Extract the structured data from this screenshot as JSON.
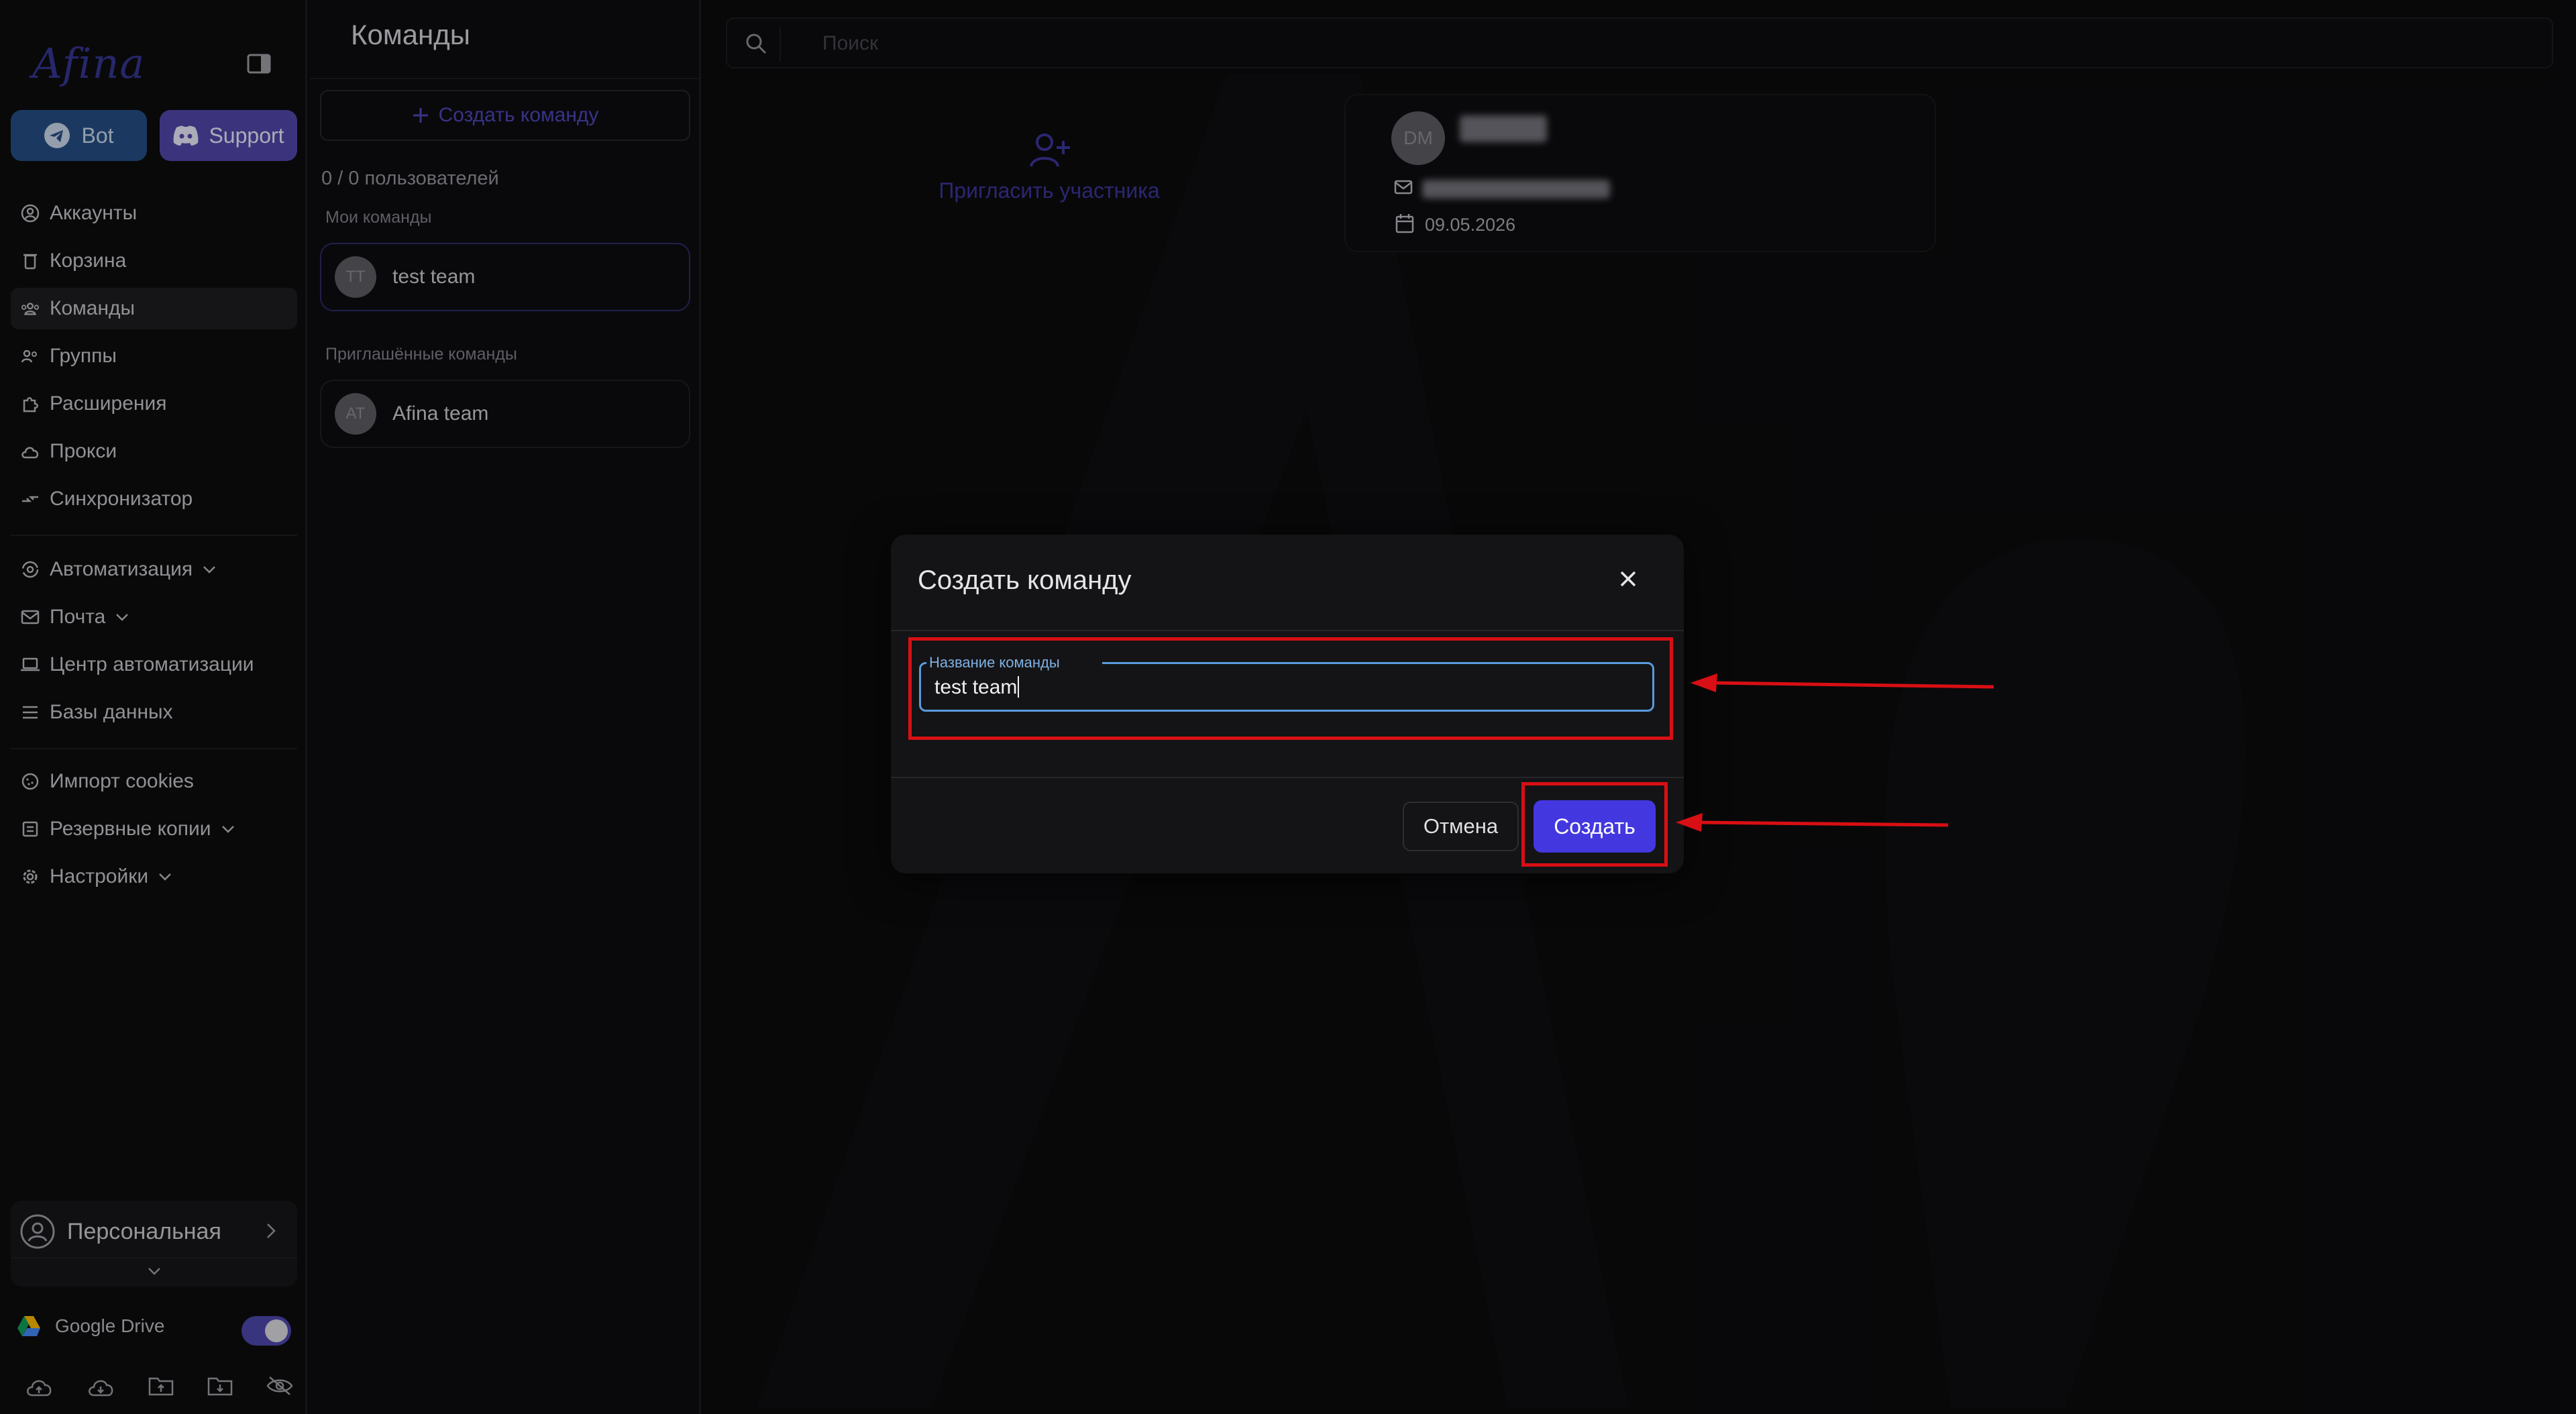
{
  "sidebar": {
    "logo": "Afina",
    "bot_label": "Bot",
    "support_label": "Support",
    "items": [
      {
        "label": "Аккаунты",
        "icon": "user-circle-icon"
      },
      {
        "label": "Корзина",
        "icon": "trash-icon"
      },
      {
        "label": "Команды",
        "icon": "team-icon",
        "active": true
      },
      {
        "label": "Группы",
        "icon": "users-group-icon"
      },
      {
        "label": "Расширения",
        "icon": "puzzle-icon"
      },
      {
        "label": "Прокси",
        "icon": "cloud-icon"
      },
      {
        "label": "Синхронизатор",
        "icon": "sync-icon"
      },
      {
        "label": "Автоматизация",
        "icon": "automation-icon",
        "expandable": true
      },
      {
        "label": "Почта",
        "icon": "mail-icon",
        "expandable": true
      },
      {
        "label": "Центр автоматизации",
        "icon": "laptop-icon"
      },
      {
        "label": "Базы данных",
        "icon": "list-icon"
      },
      {
        "label": "Импорт cookies",
        "icon": "cookie-icon"
      },
      {
        "label": "Резервные копии",
        "icon": "backup-icon",
        "expandable": true
      },
      {
        "label": "Настройки",
        "icon": "gear-icon",
        "expandable": true
      }
    ],
    "profile_label": "Персональная",
    "google_drive_label": "Google Drive",
    "google_drive_enabled": true,
    "bottom_icons": [
      "cloud-upload-icon",
      "cloud-download-icon",
      "folder-upload-icon",
      "folder-download-icon",
      "eye-off-icon"
    ]
  },
  "teams_panel": {
    "title": "Команды",
    "create_button": "Создать команду",
    "users_count": "0 / 0 пользователей",
    "my_teams_label": "Мои команды",
    "my_teams": [
      {
        "initials": "TT",
        "name": "test team"
      }
    ],
    "invited_label": "Приглашённые команды",
    "invited_teams": [
      {
        "initials": "AT",
        "name": "Afina team"
      }
    ]
  },
  "main": {
    "search_placeholder": "Поиск",
    "invite_label": "Пригласить участника",
    "member": {
      "initials": "DM",
      "date": "09.05.2026"
    }
  },
  "dialog": {
    "title": "Создать команду",
    "field_label": "Название команды",
    "field_value": "test team",
    "cancel_label": "Отмена",
    "create_label": "Создать"
  },
  "colors": {
    "accent": "#4338e0",
    "highlight": "#d80f14",
    "field_focus": "#5a9bdc",
    "background": "#0b0b0d"
  }
}
